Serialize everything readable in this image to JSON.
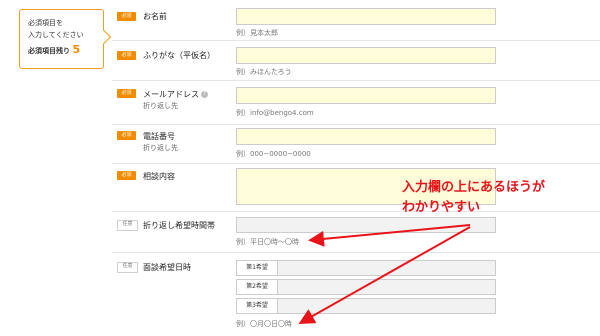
{
  "status_box": {
    "line1": "必須項目を",
    "line2": "入力してください",
    "remaining_label": "必須項目残り",
    "remaining_count": "5"
  },
  "badges": {
    "required": "必須",
    "optional": "任意"
  },
  "fields": {
    "name": {
      "label": "お名前",
      "hint": "例）見本太郎"
    },
    "furigana": {
      "label": "ふりがな（平仮名）",
      "hint": "例）みほんたろう"
    },
    "email": {
      "label": "メールアドレス",
      "sub": "折り返し先",
      "hint": "例）info@bengo4.com"
    },
    "phone": {
      "label": "電話番号",
      "sub": "折り返し先",
      "hint": "例）000−0000−0000"
    },
    "content": {
      "label": "相談内容"
    },
    "callback_time": {
      "label": "折り返し希望時間帯",
      "hint": "例）平日〇時〜〇時"
    },
    "meeting_date": {
      "label": "面談希望日時",
      "prefs": [
        "第1希望",
        "第2希望",
        "第3希望"
      ],
      "hint": "例）〇月〇日〇時"
    }
  },
  "annotation": {
    "line1": "入力欄の上にあるほうが",
    "line2": "わかりやすい"
  },
  "colors": {
    "accent": "#f08c00",
    "input_bg": "#fefcd9",
    "annotation": "#e8141a"
  }
}
